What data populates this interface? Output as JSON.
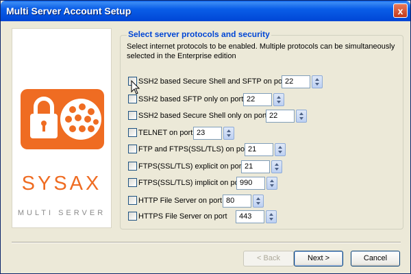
{
  "window": {
    "title": "Multi Server Account Setup",
    "close_label": "x"
  },
  "logo": {
    "word": "SYSAX",
    "subtitle": "MULTI SERVER",
    "brand_color": "#ef6c22"
  },
  "group": {
    "title": "Select server protocols and security",
    "description": "Select internet protocols to be enabled. Multiple protocols can be simultaneously selected in the Enterprise edition"
  },
  "protocols": [
    {
      "label": "SSH2 based Secure Shell and SFTP on port",
      "port": "22",
      "checked": false
    },
    {
      "label": "SSH2 based SFTP only on port",
      "port": "22",
      "checked": false
    },
    {
      "label": "SSH2 based Secure Shell only on port",
      "port": "22",
      "checked": false
    },
    {
      "label": "TELNET on port",
      "port": "23",
      "checked": false
    },
    {
      "label": "FTP and FTPS(SSL/TLS) on port",
      "port": "21",
      "checked": false
    },
    {
      "label": "FTPS(SSL/TLS) explicit on port",
      "port": "21",
      "checked": false
    },
    {
      "label": "FTPS(SSL/TLS) implicit on port",
      "port": "990",
      "checked": false
    },
    {
      "label": "HTTP File Server on port",
      "port": "80",
      "checked": false
    },
    {
      "label": "HTTPS File Server on port",
      "port": "443",
      "checked": false
    }
  ],
  "buttons": {
    "back": "< Back",
    "next": "Next >",
    "cancel": "Cancel"
  }
}
